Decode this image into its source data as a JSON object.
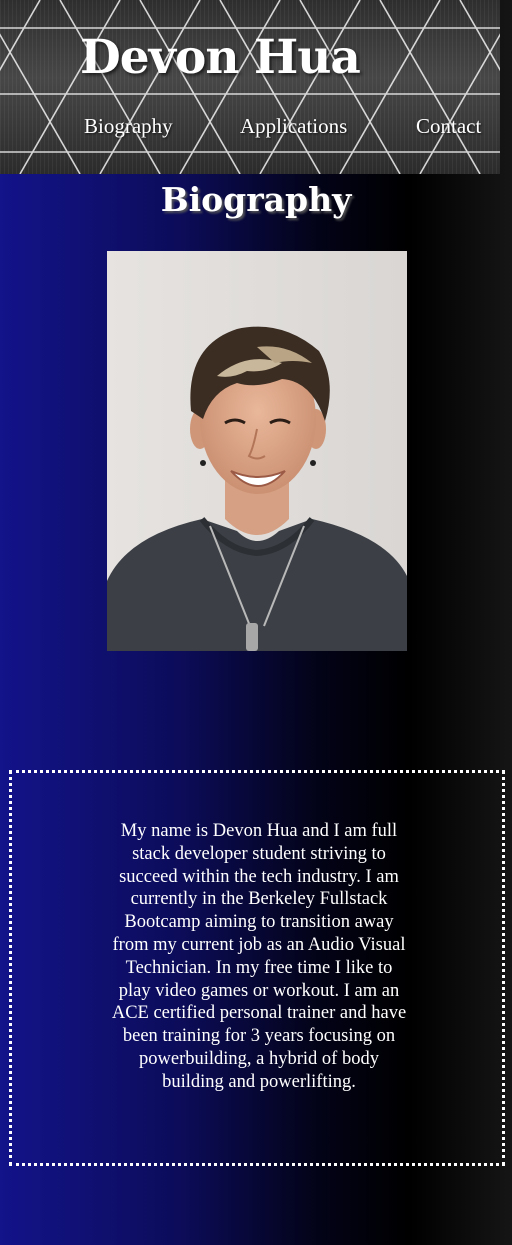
{
  "header": {
    "title": "Devon Hua",
    "nav": [
      {
        "label": "Biography"
      },
      {
        "label": "Applications"
      },
      {
        "label": "Contact"
      }
    ]
  },
  "biography": {
    "heading": "Biography",
    "photo": {
      "description": "Headshot of a smiling young man with highlighted hair, wearing a dark t-shirt and a necklace, against a white wall"
    },
    "text": "My name is Devon Hua and I am full stack developer student striving to succeed within the tech industry. I am currently in the Berkeley Fullstack Bootcamp aiming to transition away from my current job as an Audio Visual Technician. In my free time I like to play video games or workout. I am an ACE certified personal trainer and have been training for 3 years focusing on powerbuilding, a hybrid of body building and powerlifting."
  },
  "colors": {
    "gradient_start": "#13138a",
    "gradient_end": "#151515",
    "text": "#ffffff"
  }
}
